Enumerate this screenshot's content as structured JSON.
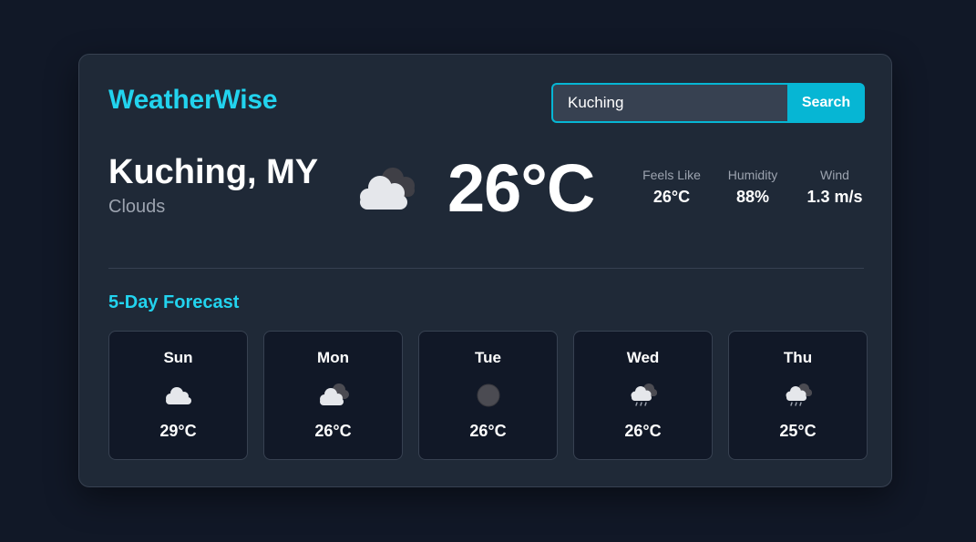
{
  "app": {
    "brand": "WeatherWise"
  },
  "search": {
    "value": "Kuching",
    "button_label": "Search"
  },
  "current": {
    "location": "Kuching, MY",
    "condition": "Clouds",
    "icon": "cloudy-icon",
    "temperature": "26°C",
    "stats": [
      {
        "label": "Feels Like",
        "value": "26°C"
      },
      {
        "label": "Humidity",
        "value": "88%"
      },
      {
        "label": "Wind",
        "value": "1.3 m/s"
      }
    ]
  },
  "forecast": {
    "title": "5-Day Forecast",
    "days": [
      {
        "day": "Sun",
        "icon": "few-clouds-icon",
        "temp": "29°C"
      },
      {
        "day": "Mon",
        "icon": "broken-clouds-icon",
        "temp": "26°C"
      },
      {
        "day": "Tue",
        "icon": "overcast-icon",
        "temp": "26°C"
      },
      {
        "day": "Wed",
        "icon": "rain-cloud-icon",
        "temp": "26°C"
      },
      {
        "day": "Thu",
        "icon": "rain-cloud-icon",
        "temp": "25°C"
      }
    ]
  },
  "colors": {
    "page_background": "#111827",
    "card_background": "#1f2937",
    "accent": "#22d3ee",
    "button": "#06b6d4",
    "muted_text": "#9ca3af",
    "border": "#374151"
  }
}
